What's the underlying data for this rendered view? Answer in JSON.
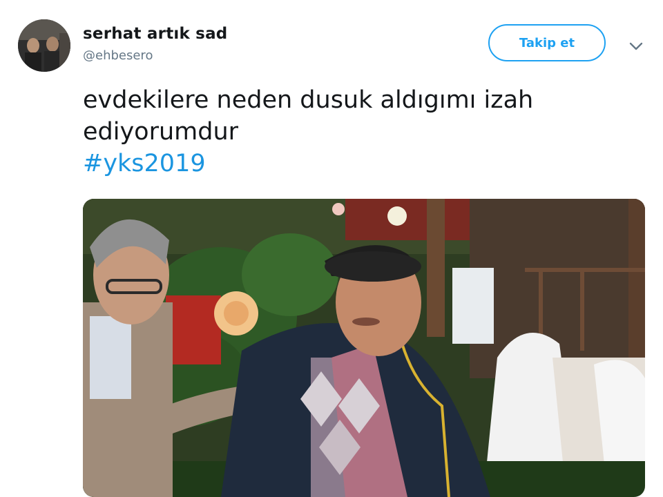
{
  "tweet": {
    "user": {
      "display_name": "serhat artık sad",
      "handle": "@ehbesero",
      "avatar_icon": "profile-photo"
    },
    "follow_label": "Takip et",
    "menu_icon": "chevron-down-icon",
    "text_line1": "evdekilere neden dusuk aldıgımı izah",
    "text_line2": "ediyorumdur",
    "hashtag": "#yks2019",
    "media_description_icon": "video-still",
    "colors": {
      "accent": "#1da1f2",
      "hashtag": "#1b95e0",
      "handle": "#657786",
      "text": "#14171a"
    }
  }
}
